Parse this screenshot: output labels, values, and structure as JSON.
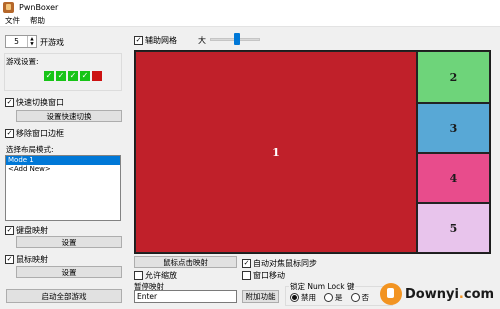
{
  "window": {
    "title": "PwnBoxer"
  },
  "menu": {
    "file": "文件",
    "help": "帮助"
  },
  "game_count": {
    "value": "5",
    "label": "开游戏"
  },
  "game_settings": {
    "label": "游戏设置:",
    "checks": [
      "✓",
      "✓",
      "✓",
      "✓"
    ]
  },
  "quick_switch": {
    "label": "快速切换窗口",
    "checked": "✓",
    "button": "设置快速切换"
  },
  "remove_border": {
    "label": "移除窗口边框",
    "checked": "✓"
  },
  "layout_mode": {
    "label": "选择布局模式:",
    "items": [
      "Mode 1",
      "<Add New>"
    ]
  },
  "keyboard_map": {
    "label": "键盘映射",
    "checked": "✓",
    "button": "设置"
  },
  "mouse_map": {
    "label": "鼠标映射",
    "checked": "✓",
    "button": "设置"
  },
  "start_all": {
    "label": "启动全部游戏"
  },
  "aux_grid": {
    "label": "辅助网格",
    "checked": "✓"
  },
  "size_slider": {
    "label": "大",
    "level_percent": 55
  },
  "panes": [
    {
      "label": "1",
      "color": "#c0202a"
    },
    {
      "label": "2",
      "color": "#6ed47a"
    },
    {
      "label": "3",
      "color": "#58a8d6"
    },
    {
      "label": "4",
      "color": "#e84c8c"
    },
    {
      "label": "5",
      "color": "#e8c4ec"
    }
  ],
  "mouse_click_map": {
    "label": "鼠标点击映射"
  },
  "allow_zoom": {
    "label": "允许缩放",
    "checked": ""
  },
  "pause_map": {
    "label": "暂停映射",
    "value": "Enter"
  },
  "extra_button": {
    "label": "附加功能"
  },
  "auto_focus_sync": {
    "label": "自动对焦鼠标同步",
    "checked": "✓"
  },
  "window_move": {
    "label": "窗口移动",
    "checked": ""
  },
  "numlock": {
    "label": "锁定 Num Lock 键",
    "options": [
      "禁用",
      "是",
      "否"
    ],
    "selected": "禁用"
  },
  "watermark": {
    "name": "Downyi",
    "dot": ".",
    "suffix": "com"
  }
}
